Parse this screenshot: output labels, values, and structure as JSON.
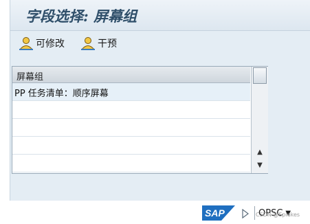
{
  "window": {
    "title": "字段选择: 屏幕组"
  },
  "toolbar": {
    "buttons": [
      {
        "label": "可修改",
        "icon": "user-edit-icon"
      },
      {
        "label": "干预",
        "icon": "user-intervene-icon"
      }
    ]
  },
  "table": {
    "column_header": "屏幕组",
    "rows": [
      "PP 任务清单：顺序屏幕",
      "",
      "",
      "",
      "",
      ""
    ]
  },
  "status_bar": {
    "logo": "SAP",
    "system": "OPSC"
  },
  "watermark": "CSDN @Spiakes",
  "colors": {
    "title": "#2f4f6a",
    "window_bg": "#e4edf4",
    "sap_blue": "#1f6fc0"
  }
}
